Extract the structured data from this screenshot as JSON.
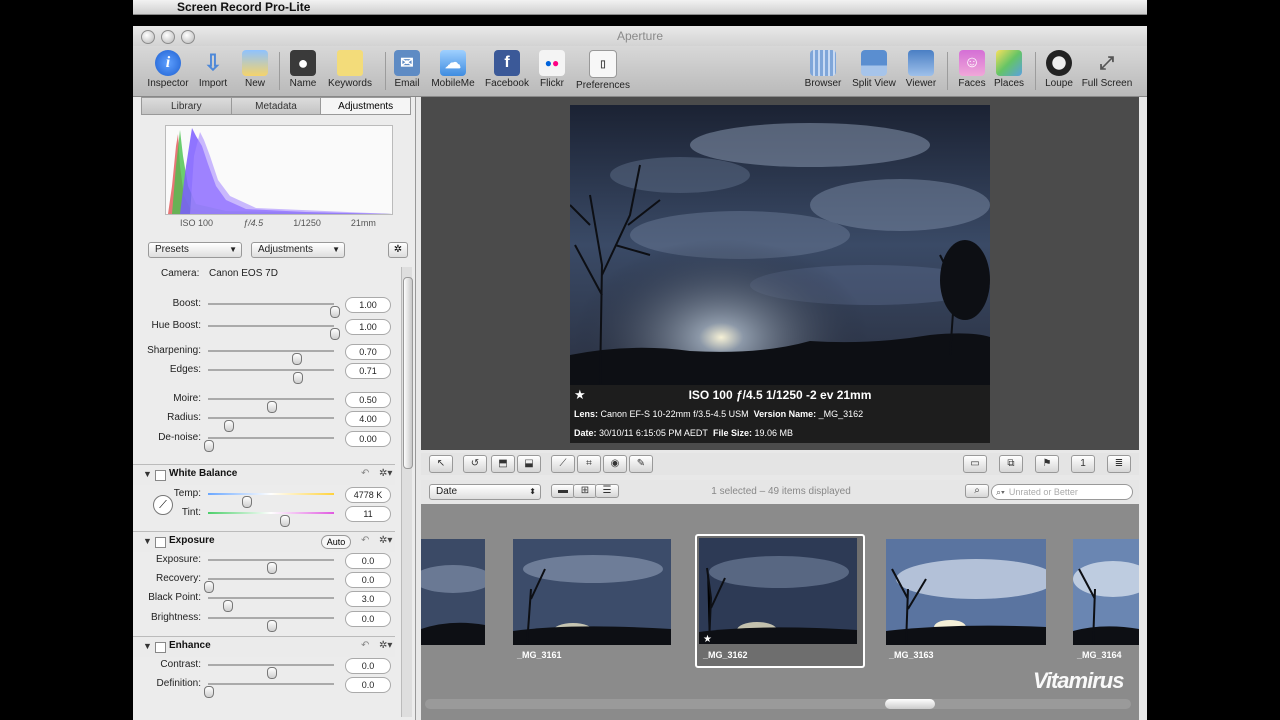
{
  "menubar": {
    "app": "Screen Record Pro-Lite"
  },
  "window": {
    "title": "Aperture"
  },
  "toolbar": {
    "left": [
      {
        "label": "Inspector",
        "icon": "info-icon"
      },
      {
        "label": "Import",
        "icon": "import-arrow-icon"
      },
      {
        "label": "New",
        "icon": "new-icon"
      },
      {
        "label": "Name",
        "icon": "person-icon"
      },
      {
        "label": "Keywords",
        "icon": "tag-icon"
      },
      {
        "label": "Email",
        "icon": "email-icon"
      },
      {
        "label": "MobileMe",
        "icon": "cloud-icon"
      },
      {
        "label": "Facebook",
        "icon": "facebook-icon"
      },
      {
        "label": "Flickr",
        "icon": "flickr-icon"
      },
      {
        "label": "Preferences",
        "icon": "switch-icon"
      }
    ],
    "right": [
      {
        "label": "Browser",
        "icon": "grid-icon"
      },
      {
        "label": "Split View",
        "icon": "split-view-icon"
      },
      {
        "label": "Viewer",
        "icon": "viewer-icon"
      },
      {
        "label": "Faces",
        "icon": "faces-icon"
      },
      {
        "label": "Places",
        "icon": "map-icon"
      },
      {
        "label": "Loupe",
        "icon": "loupe-icon"
      },
      {
        "label": "Full Screen",
        "icon": "fullscreen-icon"
      }
    ]
  },
  "tabs": [
    "Library",
    "Metadata",
    "Adjustments"
  ],
  "histogram": {
    "iso": "ISO 100",
    "aperture": "ƒ/4.5",
    "shutter": "1/1250",
    "focal": "21mm"
  },
  "presets_label": "Presets",
  "adjustments_label": "Adjustments",
  "camera": {
    "label": "Camera:",
    "value": "Canon EOS 7D"
  },
  "sliders": [
    {
      "label": "Boost:",
      "value": "1.00",
      "pos": 1.0
    },
    {
      "label": "Hue Boost:",
      "value": "1.00",
      "pos": 1.0
    },
    {
      "label": "Sharpening:",
      "value": "0.70",
      "pos": 0.7
    },
    {
      "label": "Edges:",
      "value": "0.71",
      "pos": 0.71
    },
    {
      "label": "Moire:",
      "value": "0.50",
      "pos": 0.5
    },
    {
      "label": "Radius:",
      "value": "4.00",
      "pos": 0.16
    },
    {
      "label": "De-noise:",
      "value": "0.00",
      "pos": 0.0
    }
  ],
  "white_balance": {
    "title": "White Balance",
    "temp_label": "Temp:",
    "temp_value": "4778 K",
    "temp_pos": 0.3,
    "tint_label": "Tint:",
    "tint_value": "11",
    "tint_pos": 0.6
  },
  "exposure": {
    "title": "Exposure",
    "auto": "Auto",
    "rows": [
      {
        "label": "Exposure:",
        "value": "0.0",
        "pos": 0.5
      },
      {
        "label": "Recovery:",
        "value": "0.0",
        "pos": 0.0
      },
      {
        "label": "Black Point:",
        "value": "3.0",
        "pos": 0.15
      },
      {
        "label": "Brightness:",
        "value": "0.0",
        "pos": 0.5
      }
    ]
  },
  "enhance": {
    "title": "Enhance",
    "rows": [
      {
        "label": "Contrast:",
        "value": "0.0",
        "pos": 0.5
      },
      {
        "label": "Definition:",
        "value": "0.0",
        "pos": 0.0
      }
    ]
  },
  "overlay": {
    "star": "★",
    "exif": "ISO 100     ƒ/4.5     1/1250     -2 ev     21mm",
    "lens_label": "Lens:",
    "lens_value": "Canon EF-S 10-22mm f/3.5-4.5 USM",
    "version_label": "Version Name:",
    "version_value": "_MG_3162",
    "date_label": "Date:",
    "date_value": "30/10/11 6:15:05 PM AEDT",
    "size_label": "File Size:",
    "size_value": "19.06 MB"
  },
  "browser": {
    "sort": "Date",
    "status": "1 selected – 49 items displayed",
    "search_placeholder": "Unrated or Better"
  },
  "thumbnails": [
    "_MG_3161",
    "_MG_3162",
    "_MG_3163",
    "_MG_3164"
  ],
  "watermark": "Vitamirus"
}
